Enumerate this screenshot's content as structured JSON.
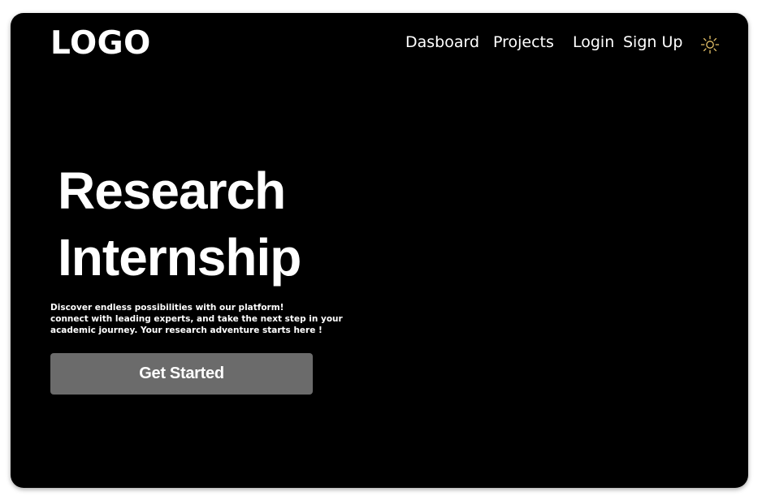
{
  "header": {
    "logo": "LOGO",
    "nav": [
      {
        "label": "Dasboard"
      },
      {
        "label": "Projects"
      },
      {
        "label": "Login"
      },
      {
        "label": "Sign Up"
      }
    ],
    "theme_icon": "sun-icon"
  },
  "hero": {
    "title_lines": [
      "Research",
      "Internship"
    ],
    "description_lines": [
      "Discover endless possibilities with our platform!",
      "connect with leading experts, and take the next step in your",
      "academic journey. Your research adventure starts here !"
    ],
    "cta_label": "Get Started"
  },
  "colors": {
    "background": "#000000",
    "text": "#ffffff",
    "button": "#6b6b6b",
    "sun_icon": "#e8c46a"
  }
}
